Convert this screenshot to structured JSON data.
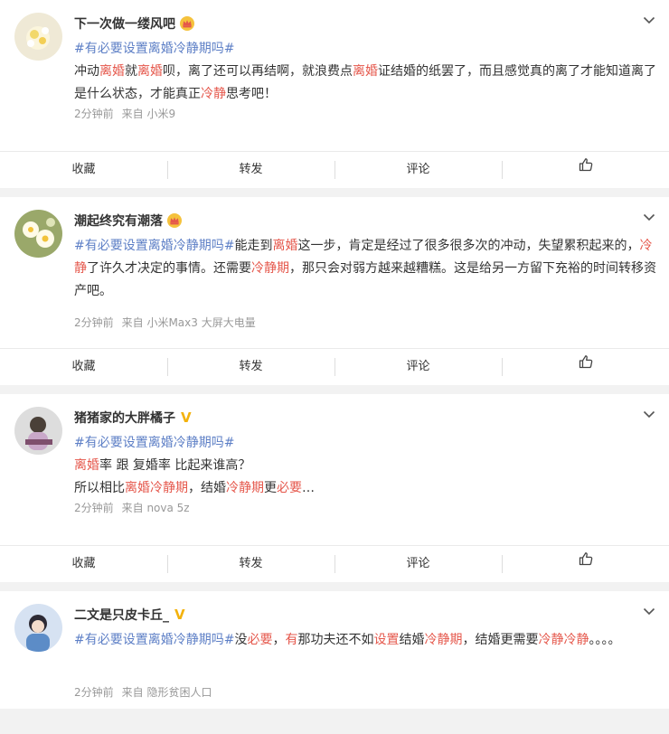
{
  "actions": {
    "collect": "收藏",
    "repost": "转发",
    "comment": "评论"
  },
  "colors": {
    "topic": "#5d7fc6",
    "keyword": "#e5574b",
    "meta": "#999999"
  },
  "posts": [
    {
      "user": "下一次做一缕风吧",
      "badge": "crown",
      "topic": "#有必要设置离婚冷静期吗#",
      "segments": [
        {
          "t": "冲动",
          "k": false
        },
        {
          "t": "离婚",
          "k": true
        },
        {
          "t": "就",
          "k": false
        },
        {
          "t": "离婚",
          "k": true
        },
        {
          "t": "呗，离了还可以再结啊，就浪费点",
          "k": false
        },
        {
          "t": "离婚",
          "k": true
        },
        {
          "t": "证结婚的纸罢了，而且感觉真的离了才能知道离了是什么状态，才能真正",
          "k": false
        },
        {
          "t": "冷静",
          "k": true
        },
        {
          "t": "思考吧！",
          "k": false
        }
      ],
      "time": "2分钟前",
      "source": "来自 小米9"
    },
    {
      "user": "潮起终究有潮落",
      "badge": "crown",
      "topic": "#有必要设置离婚冷静期吗#",
      "segments": [
        {
          "t": "能走到",
          "k": false
        },
        {
          "t": "离婚",
          "k": true
        },
        {
          "t": "这一步，肯定是经过了很多很多次的冲动，失望累积起来的，",
          "k": false
        },
        {
          "t": "冷静",
          "k": true
        },
        {
          "t": "了许久才决定的事情。还需要",
          "k": false
        },
        {
          "t": "冷静期",
          "k": true
        },
        {
          "t": "，那只会对弱方越来越糟糕。这是给另一方留下充裕的时间转移资产吧。",
          "k": false
        }
      ],
      "time": "2分钟前",
      "source": "来自 小米Max3 大屏大电量"
    },
    {
      "user": "猪猪家的大胖橘子",
      "badge": "v",
      "topic": "#有必要设置离婚冷静期吗#",
      "line2": [
        {
          "t": "离婚",
          "k": true
        },
        {
          "t": "率 跟 复婚率 比起来谁高？",
          "k": false
        }
      ],
      "line3": [
        {
          "t": "所以相比",
          "k": false
        },
        {
          "t": "离婚冷静期",
          "k": true
        },
        {
          "t": "，结婚",
          "k": false
        },
        {
          "t": "冷静期",
          "k": true
        },
        {
          "t": "更",
          "k": false
        },
        {
          "t": "必要",
          "k": true
        },
        {
          "t": "…",
          "k": false
        }
      ],
      "time": "2分钟前",
      "source": "来自 nova 5z"
    },
    {
      "user": "二文是只皮卡丘_",
      "badge": "v",
      "topic": "#有必要设置离婚冷静期吗#",
      "segments": [
        {
          "t": "没",
          "k": false
        },
        {
          "t": "必要",
          "k": true
        },
        {
          "t": "，",
          "k": false
        },
        {
          "t": "有",
          "k": true
        },
        {
          "t": "那功夫还不如",
          "k": false
        },
        {
          "t": "设置",
          "k": true
        },
        {
          "t": "结婚",
          "k": false
        },
        {
          "t": "冷静期",
          "k": true
        },
        {
          "t": "，结婚更需要",
          "k": false
        },
        {
          "t": "冷静冷静",
          "k": true
        },
        {
          "t": "。。。。",
          "k": false
        }
      ],
      "time": "2分钟前",
      "source": "来自 隐形贫困人口"
    }
  ]
}
